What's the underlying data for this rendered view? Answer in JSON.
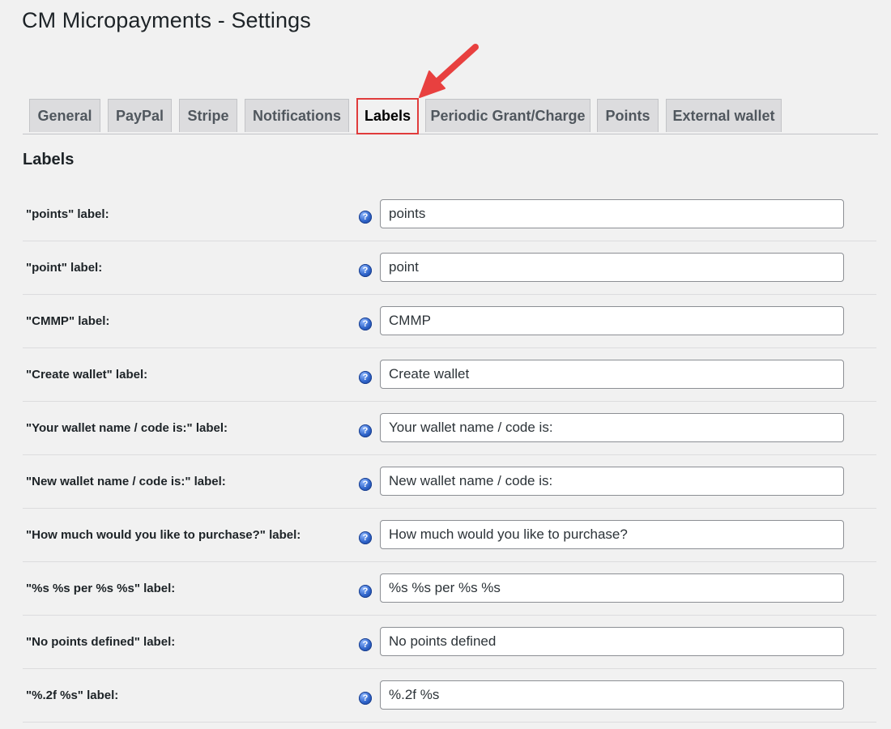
{
  "page": {
    "title": "CM Micropayments - Settings"
  },
  "tabs": [
    {
      "label": "General",
      "active": false
    },
    {
      "label": "PayPal",
      "active": false
    },
    {
      "label": "Stripe",
      "active": false
    },
    {
      "label": "Notifications",
      "active": false
    },
    {
      "label": "Labels",
      "active": true
    },
    {
      "label": "Periodic Grant/Charge",
      "active": false
    },
    {
      "label": "Points",
      "active": false
    },
    {
      "label": "External wallet",
      "active": false
    }
  ],
  "section": {
    "heading": "Labels"
  },
  "fields": [
    {
      "label": "\"points\" label:",
      "value": "points"
    },
    {
      "label": "\"point\" label:",
      "value": "point"
    },
    {
      "label": "\"CMMP\" label:",
      "value": "CMMP"
    },
    {
      "label": "\"Create wallet\" label:",
      "value": "Create wallet"
    },
    {
      "label": "\"Your wallet name / code is:\" label:",
      "value": "Your wallet name / code is:"
    },
    {
      "label": "\"New wallet name / code is:\" label:",
      "value": "New wallet name / code is:"
    },
    {
      "label": "\"How much would you like to purchase?\" label:",
      "value": "How much would you like to purchase?"
    },
    {
      "label": "\"%s %s per %s %s\" label:",
      "value": "%s %s per %s %s"
    },
    {
      "label": "\"No points defined\" label:",
      "value": "No points defined"
    },
    {
      "label": "\"%.2f %s\" label:",
      "value": "%.2f %s"
    }
  ],
  "icons": {
    "help": "help-question-icon",
    "annotation": "red-arrow"
  },
  "colors": {
    "highlight": "#e03c3c",
    "background": "#f1f1f1",
    "tab_inactive": "#dcdcde",
    "help_icon": "#2e63c9"
  }
}
